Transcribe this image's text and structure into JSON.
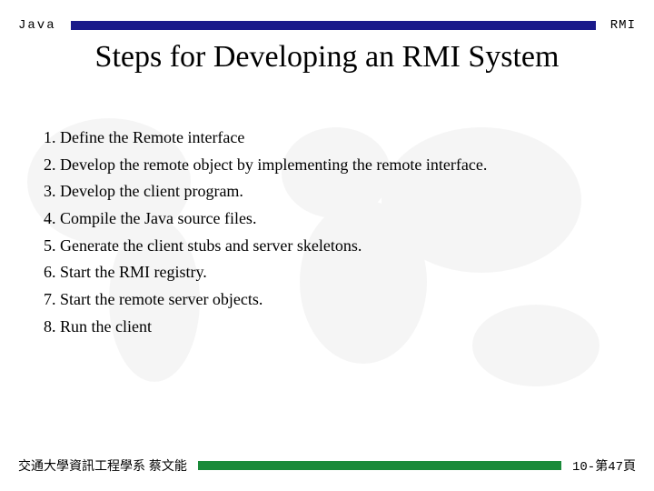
{
  "header": {
    "left": "Java",
    "right": "RMI"
  },
  "title": "Steps for Developing an RMI System",
  "steps": [
    "1. Define the Remote interface",
    "2. Develop the remote object by implementing the remote interface.",
    "3. Develop the client program.",
    "4. Compile the Java source files.",
    "5. Generate the client stubs and server skeletons.",
    "6. Start the RMI registry.",
    "7. Start the remote server objects.",
    "8. Run the client"
  ],
  "footer": {
    "left": "交通大學資訊工程學系 蔡文能",
    "right": "10-第47頁"
  }
}
